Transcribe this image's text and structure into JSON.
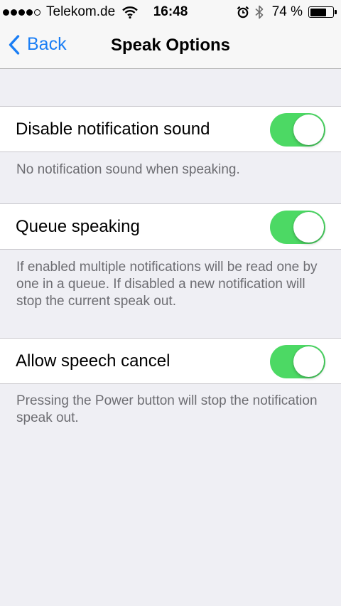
{
  "status_bar": {
    "carrier": "Telekom.de",
    "time": "16:48",
    "battery_percent": "74 %",
    "battery_level": 0.74,
    "icons": [
      "signal-dots-icon",
      "wifi-icon",
      "alarm-icon",
      "bluetooth-icon",
      "battery-icon"
    ]
  },
  "nav": {
    "back_label": "Back",
    "title": "Speak Options"
  },
  "settings": [
    {
      "label": "Disable notification sound",
      "enabled": true,
      "footer": "No notification sound when speaking."
    },
    {
      "label": "Queue speaking",
      "enabled": true,
      "footer": "If enabled multiple notifications will be read one by one in a queue. If disabled a new notification will stop the current speak out."
    },
    {
      "label": "Allow speech cancel",
      "enabled": true,
      "footer": "Pressing the Power button will stop the notification speak out."
    }
  ],
  "colors": {
    "accent": "#1a7ef5",
    "toggle_on": "#4cd964",
    "background": "#efeff4",
    "footer_text": "#6d6d72"
  }
}
